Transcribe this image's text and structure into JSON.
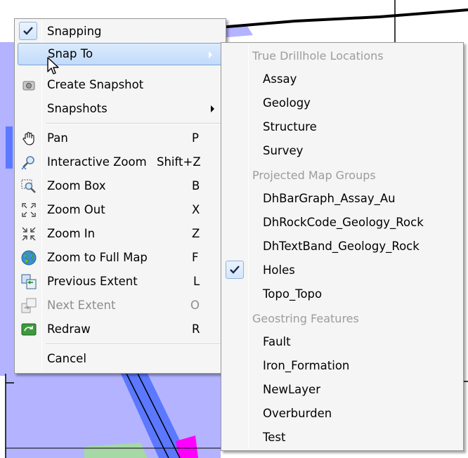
{
  "main_menu": {
    "items": [
      {
        "label": "Snapping",
        "shortcut": "",
        "checked": true,
        "icon": "check-icon"
      },
      {
        "label": "Snap To",
        "shortcut": "",
        "submenu": true,
        "highlighted": true
      },
      {
        "label": "Create Snapshot",
        "shortcut": "",
        "icon": "camera-icon"
      },
      {
        "label": "Snapshots",
        "shortcut": "",
        "submenu": true
      },
      {
        "label": "Pan",
        "shortcut": "P",
        "icon": "hand-icon"
      },
      {
        "label": "Interactive Zoom",
        "shortcut": "Shift+Z",
        "icon": "interactive-zoom-icon"
      },
      {
        "label": "Zoom Box",
        "shortcut": "B",
        "icon": "zoom-box-icon"
      },
      {
        "label": "Zoom Out",
        "shortcut": "X",
        "icon": "zoom-out-icon"
      },
      {
        "label": "Zoom In",
        "shortcut": "Z",
        "icon": "zoom-in-icon"
      },
      {
        "label": "Zoom to Full Map",
        "shortcut": "F",
        "icon": "globe-icon"
      },
      {
        "label": "Previous Extent",
        "shortcut": "L",
        "icon": "previous-extent-icon"
      },
      {
        "label": "Next Extent",
        "shortcut": "O",
        "icon": "next-extent-icon",
        "disabled": true
      },
      {
        "label": "Redraw",
        "shortcut": "R",
        "icon": "redraw-icon"
      },
      {
        "label": "Cancel",
        "shortcut": ""
      }
    ]
  },
  "sub_menu": {
    "groups": [
      {
        "header": "True Drillhole Locations",
        "items": [
          "Assay",
          "Geology",
          "Structure",
          "Survey"
        ]
      },
      {
        "header": "Projected Map Groups",
        "items": [
          "DhBarGraph_Assay_Au",
          "DhRockCode_Geology_Rock",
          "DhTextBand_Geology_Rock",
          "Holes",
          "Topo_Topo"
        ]
      },
      {
        "header": "Geostring Features",
        "items": [
          "Fault",
          "Iron_Formation",
          "NewLayer",
          "Overburden",
          "Test"
        ]
      }
    ],
    "checked_item": "Holes"
  },
  "colors": {
    "highlight": "#c1dbfc",
    "disabled_text": "#8d8d8d",
    "header_text": "#9c9c9c",
    "map_fill": "#a9a9ff",
    "map_band": "#5b78ff",
    "map_magenta": "#ff00ff"
  }
}
